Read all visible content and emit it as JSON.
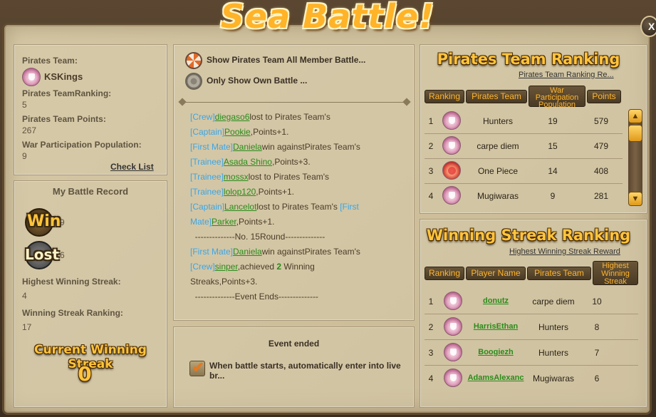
{
  "title": "Sea Battle!",
  "close_label": "X",
  "team_info": {
    "team_label": "Pirates Team:",
    "team_name": "KSKings",
    "ranking_label": "Pirates TeamRanking:",
    "ranking_value": "5",
    "points_label": "Pirates Team Points:",
    "points_value": "267",
    "population_label": "War Participation Population:",
    "population_value": "9",
    "check_list_link": "Check List"
  },
  "battle_record": {
    "heading": "My Battle Record",
    "win_word": "Win",
    "win_count": "9",
    "lost_word": "Lost",
    "lost_count": "6",
    "highest_streak_label": "Highest Winning Streak:",
    "highest_streak_value": "4",
    "streak_ranking_label": "Winning Streak Ranking:",
    "streak_ranking_value": "17",
    "current_streak_label": "Current Winning Streak",
    "current_streak_value": "0"
  },
  "battle_filter": {
    "option_all": "Show Pirates Team All Member Battle...",
    "option_own": "Only Show Own Battle ..."
  },
  "log_lines": [
    [
      [
        "role",
        "[Crew]"
      ],
      [
        "name",
        "diegaso6"
      ],
      [
        "text",
        "lost to Pirates Team's"
      ]
    ],
    [
      [
        "role",
        "[Captain]"
      ],
      [
        "name",
        "Pookie"
      ],
      [
        "text",
        ",Points+1."
      ]
    ],
    [
      [
        "role",
        "[First Mate]"
      ],
      [
        "name",
        "Daniela"
      ],
      [
        "text",
        "win againstPirates Team's"
      ]
    ],
    [
      [
        "role",
        "[Trainee]"
      ],
      [
        "name",
        "Asada Shino"
      ],
      [
        "text",
        ",Points+3."
      ]
    ],
    [
      [
        "role",
        "[Trainee]"
      ],
      [
        "name",
        "mossx"
      ],
      [
        "text",
        "lost to Pirates Team's"
      ]
    ],
    [
      [
        "role",
        "[Trainee]"
      ],
      [
        "name",
        "lolop120"
      ],
      [
        "text",
        ",Points+1."
      ]
    ],
    [
      [
        "role",
        "[Captain]"
      ],
      [
        "name",
        "Lancelot"
      ],
      [
        "text",
        "lost to Pirates Team's "
      ],
      [
        "role",
        "[First"
      ]
    ],
    [
      [
        "role",
        "Mate]"
      ],
      [
        "name",
        "Parker"
      ],
      [
        "text",
        ",Points+1."
      ]
    ],
    [
      [
        "text",
        "  --------------No. 15Round--------------"
      ]
    ],
    [
      [
        "role",
        "[First Mate]"
      ],
      [
        "name",
        "Daniela"
      ],
      [
        "text",
        "win againstPirates Team's"
      ]
    ],
    [
      [
        "role",
        "[Crew]"
      ],
      [
        "name",
        "sinper"
      ],
      [
        "text",
        ",achieved "
      ],
      [
        "num",
        "2"
      ],
      [
        "text",
        " Winning"
      ]
    ],
    [
      [
        "text",
        "Streaks,Points+3."
      ]
    ],
    [
      [
        "text",
        "  --------------Event Ends--------------"
      ]
    ]
  ],
  "event_status": {
    "text": "Event ended",
    "auto_enter_label": "When battle starts, automatically enter into live br...",
    "auto_enter_checked": true
  },
  "team_ranking": {
    "heading": "Pirates Team Ranking",
    "link": "Pirates Team Ranking Re...",
    "columns": [
      "Ranking",
      "Pirates Team",
      "War Participation Population",
      "Points"
    ],
    "rows": [
      {
        "rank": "1",
        "team": "Hunters",
        "population": "19",
        "points": "579",
        "emblem": "pink-emblem"
      },
      {
        "rank": "2",
        "team": "carpe diem",
        "population": "15",
        "points": "479",
        "emblem": "pink-emblem"
      },
      {
        "rank": "3",
        "team": "One Piece",
        "population": "14",
        "points": "408",
        "emblem": "red-heart-emblem"
      },
      {
        "rank": "4",
        "team": "Mugiwaras",
        "population": "9",
        "points": "281",
        "emblem": "pink-emblem"
      }
    ]
  },
  "streak_ranking": {
    "heading": "Winning Streak Ranking",
    "link": "Highest Winning Streak Reward",
    "columns": [
      "Ranking",
      "Player Name",
      "Pirates Team",
      "Highest Winning Streak"
    ],
    "rows": [
      {
        "rank": "1",
        "player": "donutz",
        "team": "carpe diem",
        "streak": "10"
      },
      {
        "rank": "2",
        "player": "HarrisEthan",
        "team": "Hunters",
        "streak": "8"
      },
      {
        "rank": "3",
        "player": "Boogiezh",
        "team": "Hunters",
        "streak": "7"
      },
      {
        "rank": "4",
        "player": "AdamsAlexanc",
        "team": "Mugiwaras",
        "streak": "6"
      }
    ]
  },
  "colors": {
    "title": "#ffb329",
    "role": "#3aa6e8",
    "player_name": "#2a8c1a",
    "header_text": "#ffb52e"
  }
}
